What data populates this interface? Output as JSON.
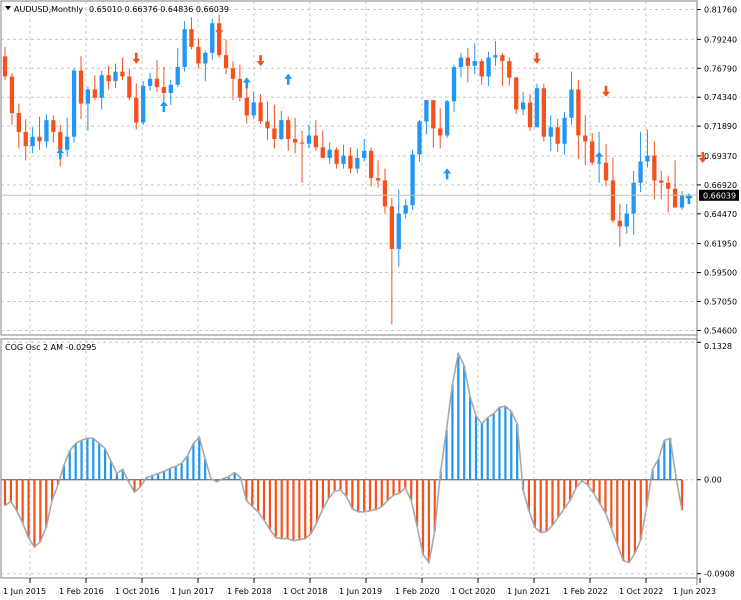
{
  "main": {
    "symbol_label": "AUDUSD,Monthly",
    "ohlc_label": "0.65010 0.66376 0.64836 0.66039",
    "last_price_label": "0.66039"
  },
  "oscillator": {
    "label": "COG Osc 2 AM -0.0295"
  },
  "colors": {
    "bull": "#2196f3",
    "bear": "#f4511e",
    "osc_line": "#a9a9a9",
    "grid": "#c8c8c8",
    "price_tag_bg": "#000000"
  },
  "chart_data": [
    {
      "type": "candlestick",
      "title": "AUDUSD,Monthly",
      "ylim": [
        0.543,
        0.824
      ],
      "y_ticks": [
        "0.81760",
        "0.79240",
        "0.76790",
        "0.74340",
        "0.71890",
        "0.69370",
        "0.66920",
        "0.64470",
        "0.61950",
        "0.59500",
        "0.57050",
        "0.54600"
      ],
      "last_price": 0.66039,
      "x_tick_labels": [
        "1 Jun 2015",
        "1 Feb 2016",
        "1 Oct 2016",
        "1 Jun 2017",
        "1 Feb 2018",
        "1 Oct 2018",
        "1 Jun 2019",
        "1 Feb 2020",
        "1 Oct 2020",
        "1 Jun 2021",
        "1 Feb 2022",
        "1 Oct 2022",
        "1 Jun 2023"
      ],
      "candles": [
        [
          0.778,
          0.786,
          0.758,
          0.761
        ],
        [
          0.761,
          0.764,
          0.72,
          0.73
        ],
        [
          0.73,
          0.738,
          0.7,
          0.714
        ],
        [
          0.714,
          0.725,
          0.69,
          0.702
        ],
        [
          0.702,
          0.718,
          0.696,
          0.71
        ],
        [
          0.71,
          0.727,
          0.699,
          0.706
        ],
        [
          0.706,
          0.729,
          0.701,
          0.724
        ],
        [
          0.724,
          0.728,
          0.705,
          0.714
        ],
        [
          0.714,
          0.72,
          0.685,
          0.699
        ],
        [
          0.699,
          0.726,
          0.693,
          0.71
        ],
        [
          0.71,
          0.768,
          0.705,
          0.766
        ],
        [
          0.766,
          0.778,
          0.725,
          0.738
        ],
        [
          0.738,
          0.752,
          0.715,
          0.75
        ],
        [
          0.75,
          0.762,
          0.741,
          0.743
        ],
        [
          0.743,
          0.766,
          0.733,
          0.762
        ],
        [
          0.762,
          0.77,
          0.75,
          0.757
        ],
        [
          0.757,
          0.772,
          0.751,
          0.765
        ],
        [
          0.765,
          0.777,
          0.758,
          0.761
        ],
        [
          0.761,
          0.767,
          0.741,
          0.743
        ],
        [
          0.743,
          0.755,
          0.716,
          0.722
        ],
        [
          0.722,
          0.757,
          0.72,
          0.753
        ],
        [
          0.753,
          0.764,
          0.749,
          0.759
        ],
        [
          0.759,
          0.775,
          0.748,
          0.752
        ],
        [
          0.752,
          0.769,
          0.74,
          0.747
        ],
        [
          0.747,
          0.758,
          0.737,
          0.754
        ],
        [
          0.754,
          0.785,
          0.752,
          0.769
        ],
        [
          0.769,
          0.808,
          0.765,
          0.801
        ],
        [
          0.801,
          0.811,
          0.784,
          0.786
        ],
        [
          0.786,
          0.793,
          0.768,
          0.772
        ],
        [
          0.772,
          0.783,
          0.757,
          0.781
        ],
        [
          0.781,
          0.81,
          0.775,
          0.806
        ],
        [
          0.806,
          0.813,
          0.777,
          0.779
        ],
        [
          0.779,
          0.792,
          0.763,
          0.768
        ],
        [
          0.768,
          0.774,
          0.741,
          0.759
        ],
        [
          0.759,
          0.771,
          0.74,
          0.743
        ],
        [
          0.743,
          0.754,
          0.721,
          0.728
        ],
        [
          0.728,
          0.748,
          0.725,
          0.739
        ],
        [
          0.739,
          0.746,
          0.721,
          0.723
        ],
        [
          0.723,
          0.74,
          0.707,
          0.717
        ],
        [
          0.717,
          0.737,
          0.7,
          0.708
        ],
        [
          0.708,
          0.732,
          0.707,
          0.724
        ],
        [
          0.724,
          0.727,
          0.698,
          0.708
        ],
        [
          0.708,
          0.726,
          0.696,
          0.705
        ],
        [
          0.705,
          0.715,
          0.671,
          0.704
        ],
        [
          0.704,
          0.72,
          0.7,
          0.711
        ],
        [
          0.711,
          0.724,
          0.698,
          0.701
        ],
        [
          0.701,
          0.715,
          0.693,
          0.692
        ],
        [
          0.692,
          0.705,
          0.687,
          0.699
        ],
        [
          0.699,
          0.701,
          0.683,
          0.687
        ],
        [
          0.687,
          0.703,
          0.683,
          0.694
        ],
        [
          0.694,
          0.701,
          0.679,
          0.683
        ],
        [
          0.683,
          0.7,
          0.679,
          0.692
        ],
        [
          0.692,
          0.708,
          0.689,
          0.698
        ],
        [
          0.698,
          0.701,
          0.668,
          0.675
        ],
        [
          0.675,
          0.69,
          0.667,
          0.673
        ],
        [
          0.673,
          0.683,
          0.645,
          0.651
        ],
        [
          0.651,
          0.658,
          0.551,
          0.615
        ],
        [
          0.615,
          0.665,
          0.6,
          0.645
        ],
        [
          0.645,
          0.657,
          0.641,
          0.652
        ],
        [
          0.652,
          0.699,
          0.648,
          0.695
        ],
        [
          0.695,
          0.724,
          0.689,
          0.723
        ],
        [
          0.723,
          0.741,
          0.712,
          0.741
        ],
        [
          0.741,
          0.733,
          0.701,
          0.717
        ],
        [
          0.717,
          0.734,
          0.7,
          0.711
        ],
        [
          0.711,
          0.741,
          0.709,
          0.74
        ],
        [
          0.74,
          0.771,
          0.731,
          0.769
        ],
        [
          0.769,
          0.781,
          0.76,
          0.777
        ],
        [
          0.777,
          0.785,
          0.756,
          0.77
        ],
        [
          0.77,
          0.789,
          0.763,
          0.774
        ],
        [
          0.774,
          0.776,
          0.754,
          0.761
        ],
        [
          0.761,
          0.782,
          0.753,
          0.777
        ],
        [
          0.777,
          0.791,
          0.77,
          0.779
        ],
        [
          0.779,
          0.781,
          0.753,
          0.774
        ],
        [
          0.774,
          0.777,
          0.753,
          0.76
        ],
        [
          0.76,
          0.761,
          0.729,
          0.733
        ],
        [
          0.733,
          0.748,
          0.728,
          0.739
        ],
        [
          0.739,
          0.746,
          0.715,
          0.718
        ],
        [
          0.718,
          0.755,
          0.718,
          0.751
        ],
        [
          0.751,
          0.755,
          0.706,
          0.71
        ],
        [
          0.71,
          0.728,
          0.698,
          0.718
        ],
        [
          0.718,
          0.725,
          0.697,
          0.704
        ],
        [
          0.704,
          0.731,
          0.695,
          0.726
        ],
        [
          0.726,
          0.765,
          0.72,
          0.75
        ],
        [
          0.75,
          0.758,
          0.691,
          0.711
        ],
        [
          0.711,
          0.728,
          0.686,
          0.706
        ],
        [
          0.706,
          0.713,
          0.686,
          0.688
        ],
        [
          0.688,
          0.714,
          0.671,
          0.688
        ],
        [
          0.688,
          0.704,
          0.668,
          0.673
        ],
        [
          0.673,
          0.692,
          0.637,
          0.639
        ],
        [
          0.639,
          0.653,
          0.617,
          0.634
        ],
        [
          0.634,
          0.653,
          0.628,
          0.645
        ],
        [
          0.645,
          0.681,
          0.627,
          0.671
        ],
        [
          0.671,
          0.714,
          0.663,
          0.689
        ],
        [
          0.689,
          0.716,
          0.684,
          0.694
        ],
        [
          0.694,
          0.706,
          0.657,
          0.673
        ],
        [
          0.673,
          0.681,
          0.657,
          0.671
        ],
        [
          0.671,
          0.677,
          0.646,
          0.666
        ],
        [
          0.666,
          0.69,
          0.65,
          0.65
        ],
        [
          0.65,
          0.664,
          0.648,
          0.6604
        ]
      ],
      "signals": [
        {
          "index": 8,
          "direction": "up",
          "price": 0.696
        },
        {
          "index": 19,
          "direction": "down",
          "price": 0.776
        },
        {
          "index": 23,
          "direction": "up",
          "price": 0.736
        },
        {
          "index": 31,
          "direction": "down",
          "price": 0.8
        },
        {
          "index": 35,
          "direction": "up",
          "price": 0.756
        },
        {
          "index": 37,
          "direction": "down",
          "price": 0.774
        },
        {
          "index": 41,
          "direction": "up",
          "price": 0.759
        },
        {
          "index": 64,
          "direction": "up",
          "price": 0.679
        },
        {
          "index": 77,
          "direction": "down",
          "price": 0.776
        },
        {
          "index": 87,
          "direction": "down",
          "price": 0.748
        },
        {
          "index": 86,
          "direction": "up",
          "price": 0.693
        },
        {
          "index": 99,
          "direction": "up",
          "price": 0.658
        },
        {
          "index": 101,
          "direction": "down",
          "price": 0.692
        }
      ]
    },
    {
      "type": "bar",
      "title": "COG Osc 2 AM -0.0295",
      "ylim": [
        -0.094,
        0.135
      ],
      "y_ticks": [
        "0.1328",
        "0.00",
        "-0.0908"
      ],
      "values": [
        -0.025,
        -0.021,
        -0.03,
        -0.042,
        -0.056,
        -0.065,
        -0.06,
        -0.046,
        -0.02,
        -0.005,
        0.014,
        0.028,
        0.035,
        0.038,
        0.04,
        0.04,
        0.035,
        0.03,
        0.018,
        0.006,
        0.01,
        -0.002,
        -0.012,
        -0.007,
        0.002,
        0.004,
        0.006,
        0.008,
        0.011,
        0.013,
        0.016,
        0.023,
        0.035,
        0.041,
        0.02,
        0.001,
        -0.002,
        0.001,
        0.003,
        0.007,
        0.002,
        -0.02,
        -0.026,
        -0.031,
        -0.039,
        -0.048,
        -0.056,
        -0.057,
        -0.057,
        -0.059,
        -0.058,
        -0.057,
        -0.052,
        -0.041,
        -0.028,
        -0.018,
        -0.011,
        -0.01,
        -0.016,
        -0.028,
        -0.031,
        -0.031,
        -0.03,
        -0.029,
        -0.026,
        -0.02,
        -0.015,
        -0.013,
        -0.008,
        -0.02,
        -0.045,
        -0.072,
        -0.08,
        -0.05,
        0.008,
        0.048,
        0.092,
        0.122,
        0.11,
        0.08,
        0.062,
        0.054,
        0.06,
        0.064,
        0.07,
        0.071,
        0.066,
        0.054,
        -0.01,
        -0.03,
        -0.046,
        -0.051,
        -0.05,
        -0.044,
        -0.036,
        -0.028,
        -0.02,
        -0.008,
        -0.001,
        -0.005,
        -0.013,
        -0.023,
        -0.032,
        -0.047,
        -0.062,
        -0.078,
        -0.08,
        -0.071,
        -0.058,
        -0.026,
        0.01,
        0.02,
        0.038,
        0.04,
        0.002,
        -0.0295
      ]
    }
  ]
}
